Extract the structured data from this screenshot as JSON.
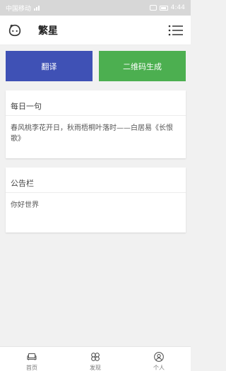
{
  "status_bar": {
    "carrier": "中国移动",
    "time": "4:44"
  },
  "app_bar": {
    "title": "繁星"
  },
  "buttons": {
    "translate": "翻译",
    "qrcode": "二维码生成"
  },
  "quote_card": {
    "title": "每日一句",
    "text": "春风桃李花开日，秋雨梧桐叶落时——白居易《长恨歌》"
  },
  "notice_card": {
    "title": "公告栏",
    "text": "你好世界"
  },
  "bottom_nav": {
    "items": [
      {
        "label": "首页",
        "icon": "sofa-icon"
      },
      {
        "label": "发现",
        "icon": "clover-icon"
      },
      {
        "label": "个人",
        "icon": "user-icon"
      }
    ]
  },
  "colors": {
    "translate_button": "#3f51b5",
    "qrcode_button": "#4caf50",
    "status_bar": "#d7d7d7",
    "background": "#f1f1f1"
  }
}
